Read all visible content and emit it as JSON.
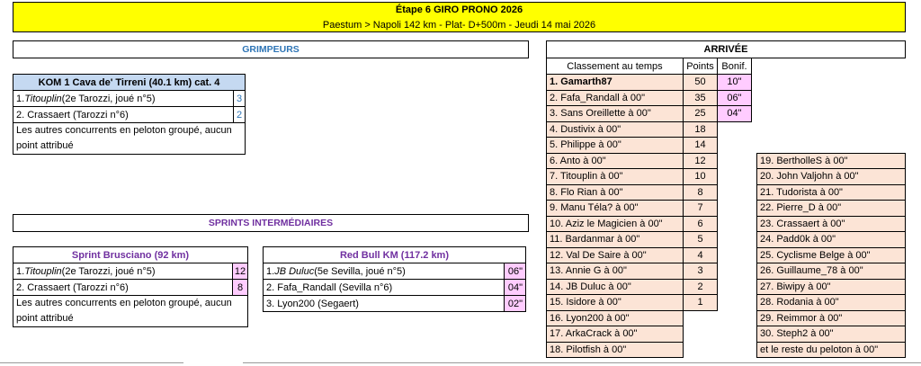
{
  "header": {
    "title": "Étape 6 GIRO PRONO 2026",
    "subtitle": "Paestum > Napoli 142 km - Plat- D+500m - Jeudi 14 mai 2026"
  },
  "grimpeurs": {
    "heading": "GRIMPEURS",
    "kom": {
      "title": "KOM 1 Cava de' Tirreni (40.1 km)   cat. 4",
      "rows": [
        {
          "name": "Titouplin",
          "rest": " (2e Tarozzi, joué n°5)",
          "pts": "3"
        },
        {
          "name": "",
          "rest": "2. Crassaert (Tarozzi n°6)",
          "pts": "2"
        }
      ],
      "rank1": "1. ",
      "note": "Les autres concurrents en peloton groupé, aucun point attribué"
    }
  },
  "sprints": {
    "heading": "SPRINTS INTERMÉDIAIRES",
    "brusciano": {
      "title": "Sprint Brusciano (92 km)",
      "rank1": "1. ",
      "name1": "Titouplin",
      "rest1": " (2e Tarozzi, joué n°5)",
      "pts1": "12",
      "row2": "2. Crassaert (Tarozzi n°6)",
      "pts2": "8",
      "note": "Les autres concurrents en peloton groupé, aucun point attribué"
    },
    "redbull": {
      "title": "Red Bull KM (117.2 km)",
      "rank1": "1. ",
      "name1": "JB Duluc",
      "rest1": " (5e Sevilla, joué n°5)",
      "b1": "06\"",
      "row2": "2. Fafa_Randall (Sevilla n°6)",
      "b2": "04\"",
      "row3": "3. Lyon200 (Segaert)",
      "b3": "02\""
    }
  },
  "arrivee": {
    "heading": "ARRIVÉE",
    "col_classement": "Classement au temps",
    "col_points": "Points",
    "col_bonif": "Bonif.",
    "rows": [
      {
        "label": "1. Gamarth87",
        "pts": "50",
        "bonif": "10\""
      },
      {
        "label": "2. Fafa_Randall à 00\"",
        "pts": "35",
        "bonif": "06\""
      },
      {
        "label": "3. Sans Oreillette à 00\"",
        "pts": "25",
        "bonif": "04\""
      },
      {
        "label": "4. Dustivix à 00\"",
        "pts": "18"
      },
      {
        "label": "5. Philippe à 00\"",
        "pts": "14"
      },
      {
        "label": "6. Anto à 00\"",
        "pts": "12"
      },
      {
        "label": "7. Titouplin à 00\"",
        "pts": "10"
      },
      {
        "label": "8. Flo Rian à 00\"",
        "pts": "8"
      },
      {
        "label": "9. Manu Téla? à 00\"",
        "pts": "7"
      },
      {
        "label": "10. Aziz le Magicien à 00\"",
        "pts": "6"
      },
      {
        "label": "11. Bardanmar à 00\"",
        "pts": "5"
      },
      {
        "label": "12. Val De Saire à 00\"",
        "pts": "4"
      },
      {
        "label": "13. Annie G à 00\"",
        "pts": "3"
      },
      {
        "label": "14. JB Duluc à 00\"",
        "pts": "2"
      },
      {
        "label": "15. Isidore à 00\"",
        "pts": "1"
      },
      {
        "label": "16. Lyon200 à 00\""
      },
      {
        "label": "17. ArkaCrack à 00\""
      },
      {
        "label": "18. Pilotfish à 00\""
      }
    ],
    "right_rows": [
      "19. BertholleS à 00\"",
      "20. John Valjohn à 00\"",
      "21. Tudorista à 00\"",
      "22. Pierre_D à 00\"",
      "23. Crassaert à 00\"",
      "24. Padd0k à 00\"",
      "25. Cyclisme Belge à 00\"",
      "26. Guillaume_78 à 00\"",
      "27. Biwipy à 00\"",
      "28. Rodania à 00\"",
      "29. Reimmor à 00\"",
      "30. Steph2 à 00\"",
      " et le reste du peloton à 00\""
    ]
  }
}
